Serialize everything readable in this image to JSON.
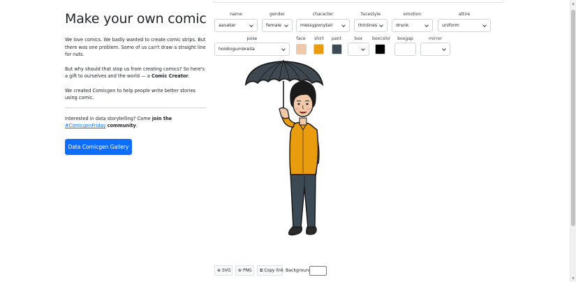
{
  "page": {
    "title": "Make your own comic",
    "intro": "We love comics. We badly wanted to create comic strips. But there was one problem. Some of us can't draw a straight line for nuts.",
    "why_prefix": "But why should that stop us from creating comics? So here's a gift to ourselves and the world — a ",
    "why_bold": "Comic Creator",
    "why_suffix": ".",
    "created": "We created Comicgen to help people write better stories using comic.",
    "story_prefix": "Interested in data storytelling? Come ",
    "story_bold": "join the",
    "story_link": "#ComicgenFriday",
    "story_suffix_bold": "community",
    "story_suffix": ".",
    "gallery_button": "Data Comicgen Gallery"
  },
  "controls": {
    "name": {
      "label": "name",
      "value": "aavatar"
    },
    "gender": {
      "label": "gender",
      "value": "female"
    },
    "character": {
      "label": "character",
      "value": "messyponytail"
    },
    "facestyle": {
      "label": "facestyle",
      "value": "thinlines"
    },
    "emotion": {
      "label": "emotion",
      "value": "drunk"
    },
    "attire": {
      "label": "attire",
      "value": "uniform"
    },
    "pose": {
      "label": "pose",
      "value": "holdingumbrella"
    },
    "face": {
      "label": "face",
      "color": "#f2c9a8"
    },
    "shirt": {
      "label": "shirt",
      "color": "#e89c0e"
    },
    "pant": {
      "label": "pant",
      "color": "#3b4a54"
    },
    "box": {
      "label": "box",
      "value": ""
    },
    "boxcolor": {
      "label": "boxcolor",
      "color": "#000000"
    },
    "boxgap": {
      "label": "boxgap",
      "value": ""
    },
    "mirror": {
      "label": "mirror",
      "value": ""
    }
  },
  "export": {
    "svg": "SVG",
    "png": "PNG",
    "copy_link": "Copy link",
    "background_label": "Background"
  },
  "colors": {
    "primary": "#0d6efd",
    "umbrella": "#3e4850",
    "hair": "#1a1a1a",
    "skin": "#f2c9a8",
    "shirt": "#e89c0e",
    "pant": "#3b4a54"
  }
}
